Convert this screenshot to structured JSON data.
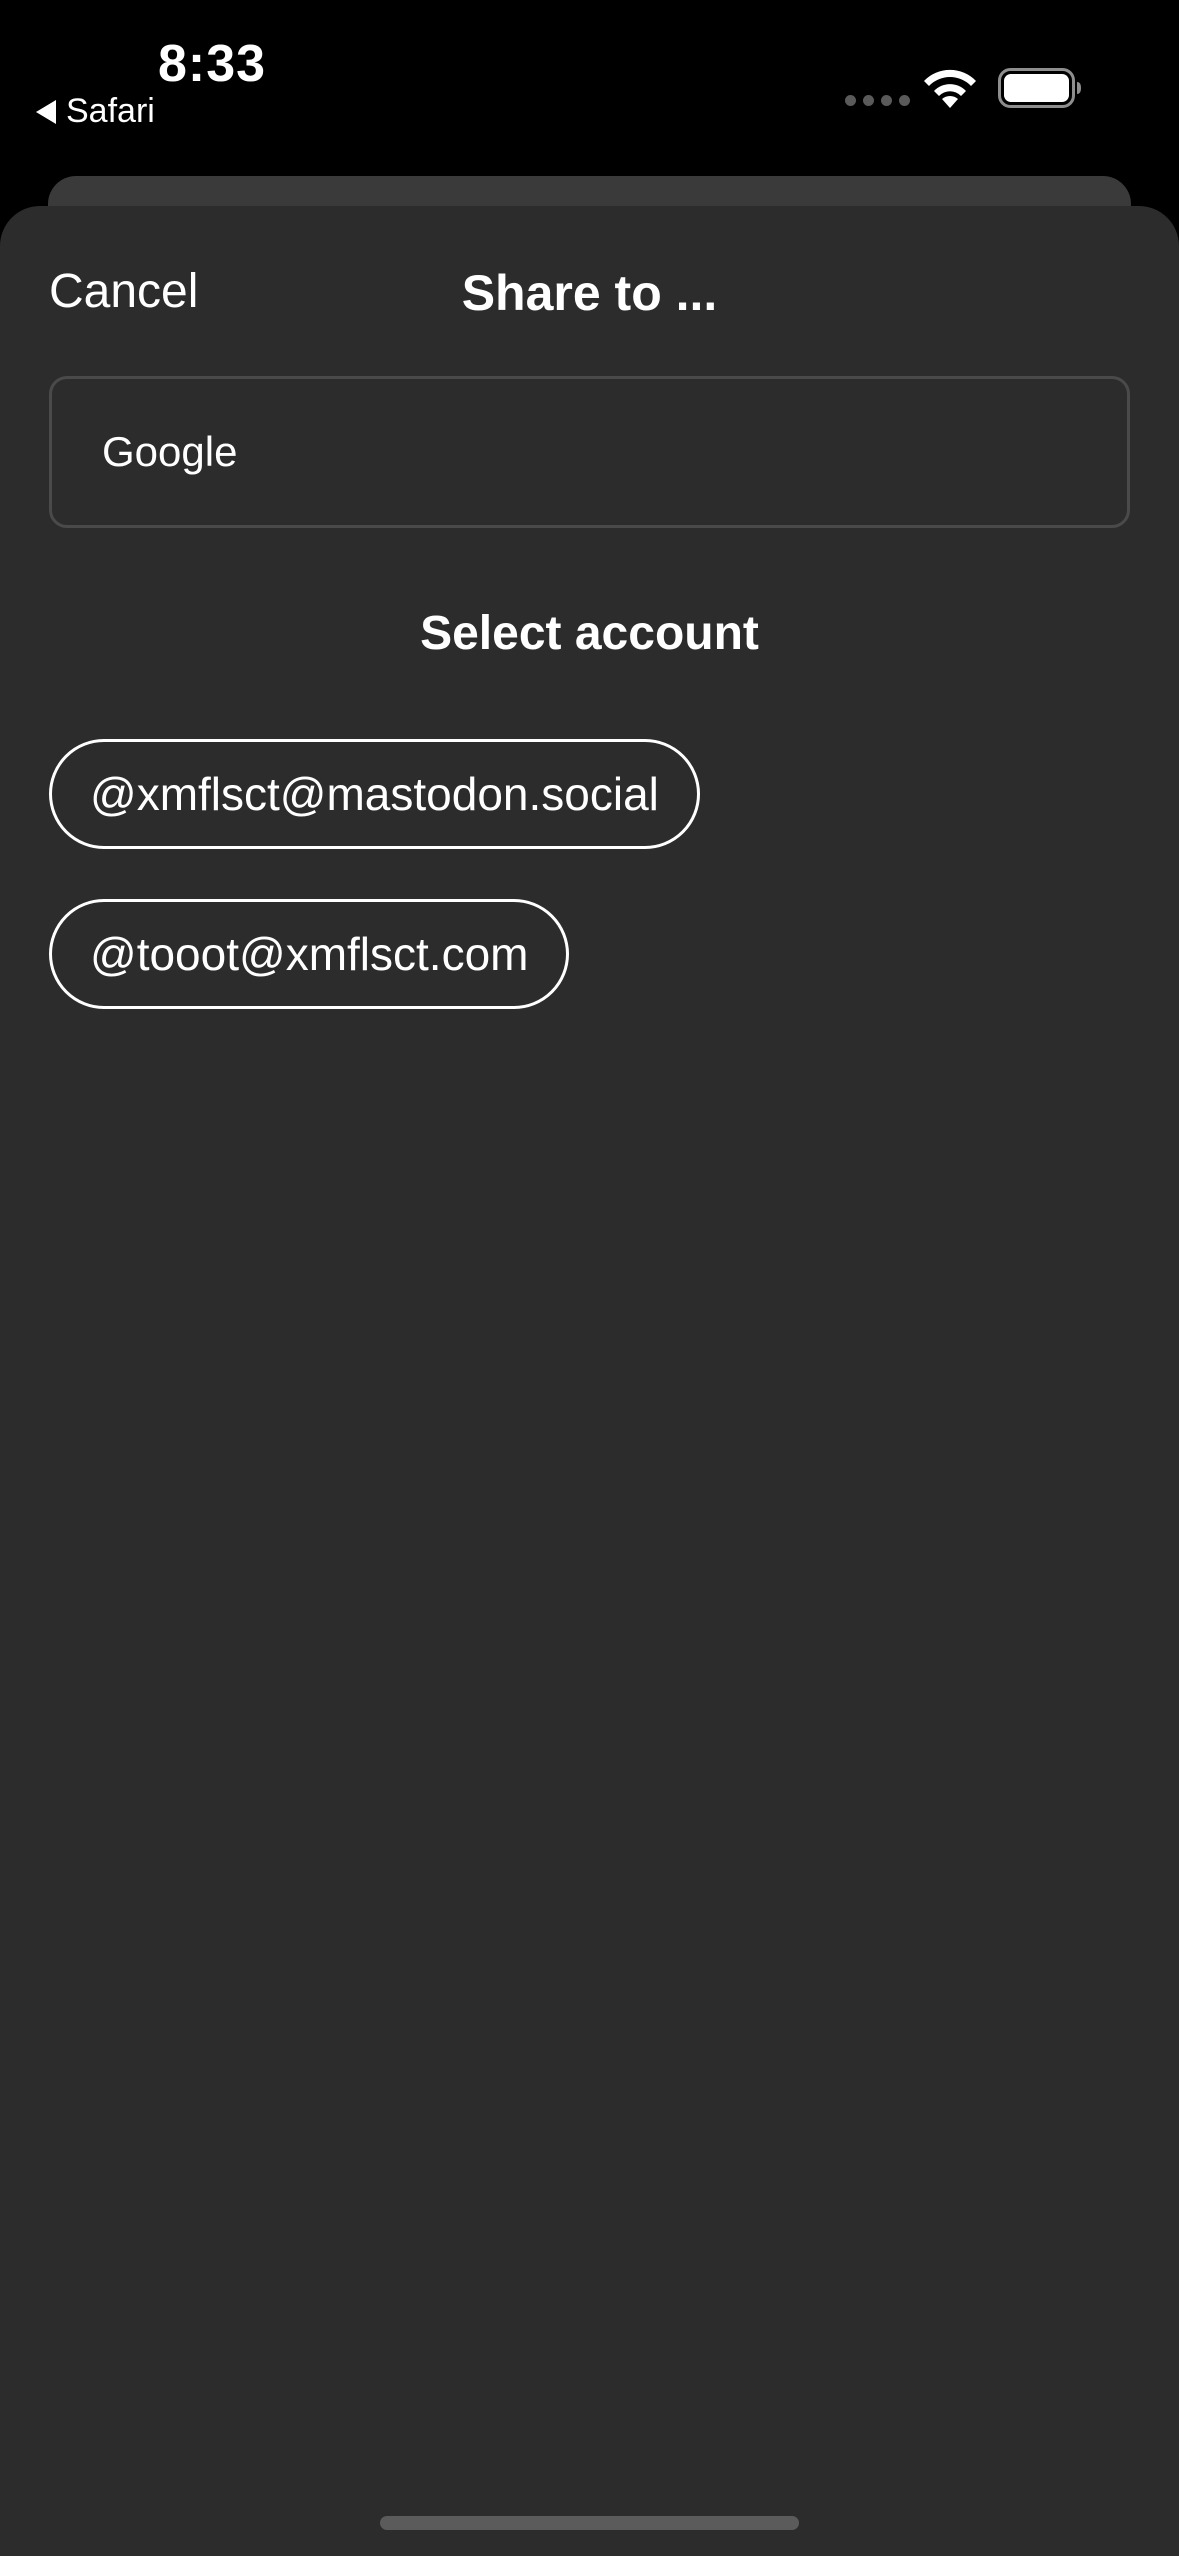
{
  "status_bar": {
    "time": "8:33",
    "back_app": "Safari"
  },
  "icons": {
    "back": "back-arrow-icon",
    "signal": "cell-signal-icon",
    "wifi": "wifi-icon",
    "battery": "battery-icon"
  },
  "sheet": {
    "cancel_label": "Cancel",
    "title": "Share to ...",
    "url_value": "Google",
    "section_title": "Select account",
    "accounts": [
      {
        "handle": "@xmflsct@mastodon.social"
      },
      {
        "handle": "@tooot@xmflsct.com"
      }
    ]
  },
  "colors": {
    "background": "#000000",
    "sheet": "#2c2c2c",
    "sheet_back": "#3a3a3a",
    "text": "#ffffff",
    "field_border": "#4a4a4a"
  }
}
